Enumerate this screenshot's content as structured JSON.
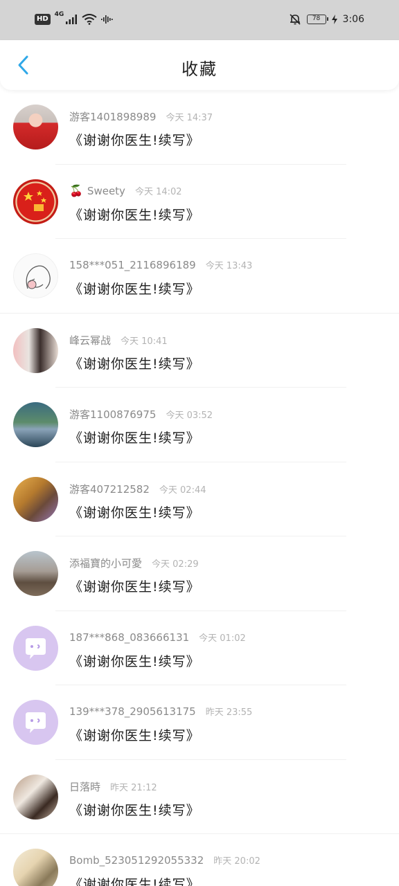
{
  "status_bar": {
    "hd_badge": "HD",
    "network": "4G",
    "battery": "78",
    "time": "3:06"
  },
  "header": {
    "title": "收藏"
  },
  "favorites": [
    {
      "username": "游客1401898989",
      "emoji": "",
      "time": "今天 14:37",
      "content": "《谢谢你医生!续写》"
    },
    {
      "username": "Sweety",
      "emoji": "🍒",
      "time": "今天 14:02",
      "content": "《谢谢你医生!续写》"
    },
    {
      "username": "158***051_2116896189",
      "emoji": "",
      "time": "今天 13:43",
      "content": "《谢谢你医生!续写》"
    },
    {
      "username": "峰云幂战",
      "emoji": "",
      "time": "今天 10:41",
      "content": "《谢谢你医生!续写》"
    },
    {
      "username": "游客1100876975",
      "emoji": "",
      "time": "今天 03:52",
      "content": "《谢谢你医生!续写》"
    },
    {
      "username": "游客407212582",
      "emoji": "",
      "time": "今天 02:44",
      "content": "《谢谢你医生!续写》"
    },
    {
      "username": "添福寶的小可愛",
      "emoji": "",
      "time": "今天 02:29",
      "content": "《谢谢你医生!续写》"
    },
    {
      "username": "187***868_083666131",
      "emoji": "",
      "time": "今天 01:02",
      "content": "《谢谢你医生!续写》"
    },
    {
      "username": "139***378_2905613175",
      "emoji": "",
      "time": "昨天 23:55",
      "content": "《谢谢你医生!续写》"
    },
    {
      "username": "日落時",
      "emoji": "",
      "time": "昨天 21:12",
      "content": "《谢谢你医生!续写》"
    },
    {
      "username": "Bomb_523051292055332",
      "emoji": "",
      "time": "昨天 20:02",
      "content": "《谢谢你医生!续写》"
    }
  ],
  "colors": {
    "accent": "#2fa8e8",
    "bot_avatar": "#d8c6f0"
  }
}
